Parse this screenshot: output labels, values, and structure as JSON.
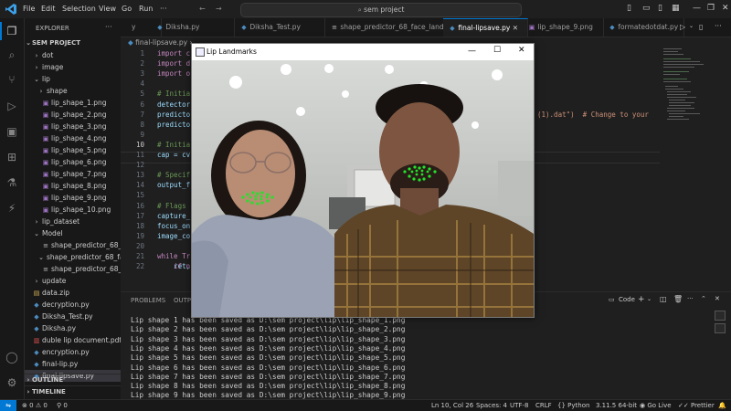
{
  "menu": [
    "File",
    "Edit",
    "Selection",
    "View",
    "Go",
    "Run"
  ],
  "search": {
    "text": "sem project"
  },
  "sidebar": {
    "header": "EXPLORER",
    "project": "SEM PROJECT",
    "items": [
      {
        "label": "dot",
        "type": "folder",
        "open": false
      },
      {
        "label": "image",
        "type": "folder",
        "open": false
      },
      {
        "label": "lip",
        "type": "folder",
        "open": true
      },
      {
        "label": "shape",
        "type": "folder",
        "open": false
      },
      {
        "label": "lip_shape_1.png",
        "type": "img"
      },
      {
        "label": "lip_shape_2.png",
        "type": "img"
      },
      {
        "label": "lip_shape_3.png",
        "type": "img"
      },
      {
        "label": "lip_shape_4.png",
        "type": "img"
      },
      {
        "label": "lip_shape_5.png",
        "type": "img"
      },
      {
        "label": "lip_shape_6.png",
        "type": "img"
      },
      {
        "label": "lip_shape_7.png",
        "type": "img"
      },
      {
        "label": "lip_shape_8.png",
        "type": "img"
      },
      {
        "label": "lip_shape_9.png",
        "type": "img"
      },
      {
        "label": "lip_shape_10.png",
        "type": "img"
      },
      {
        "label": "lip_dataset",
        "type": "folder",
        "open": false
      },
      {
        "label": "Model",
        "type": "folder",
        "open": true
      },
      {
        "label": "shape_predictor_68_f...",
        "type": "file"
      },
      {
        "label": "shape_predictor_68_fa...",
        "type": "folder",
        "open": true
      },
      {
        "label": "shape_predictor_68_f...",
        "type": "file"
      },
      {
        "label": "update",
        "type": "folder",
        "open": false
      },
      {
        "label": "data.zip",
        "type": "zip"
      },
      {
        "label": "decryption.py",
        "type": "py"
      },
      {
        "label": "Diksha_Test.py",
        "type": "py"
      },
      {
        "label": "Diksha.py",
        "type": "py"
      },
      {
        "label": "duble lip document.pdf",
        "type": "pdf"
      },
      {
        "label": "encryption.py",
        "type": "py"
      },
      {
        "label": "final-lip.py",
        "type": "py"
      },
      {
        "label": "final-lipsave.py",
        "type": "py",
        "selected": true
      }
    ],
    "outline": "OUTLINE",
    "timeline": "TIMELINE"
  },
  "tabs": [
    {
      "label": "y"
    },
    {
      "label": "Diksha.py"
    },
    {
      "label": "Diksha_Test.py"
    },
    {
      "label": "shape_predictor_68_face_landmarks.dat"
    },
    {
      "label": "final-lipsave.py",
      "active": true
    },
    {
      "label": "lip_shape_9.png"
    },
    {
      "label": "formatedotdat.py"
    }
  ],
  "breadcrumb": "final-lipsave.py",
  "code": {
    "line_numbers": [
      "1",
      "2",
      "3",
      "4",
      "5",
      "6",
      "7",
      "8",
      "9",
      "10",
      "11",
      "12",
      "13",
      "14",
      "15",
      "16",
      "17",
      "18",
      "19",
      "20",
      "21",
      "22"
    ],
    "lines": [
      "import c",
      "import d",
      "import o",
      "",
      "# Initia",
      "detector",
      "predicto",
      "predicto",
      "",
      "# Initia",
      "cap = cv",
      "",
      "# Specif",
      "output_f",
      "",
      "# Flags ",
      "capture_",
      "focus_on",
      "image_co",
      "",
      "while Tr",
      "    ret,"
    ],
    "extra_line21": "    if n",
    "right_fragment": "(1).dat\")  # Change to your"
  },
  "panel": {
    "tabs": [
      "PROBLEMS",
      "OUTPUT"
    ],
    "shell": "Code",
    "terminal_lines": [
      "Lip shape 1 has been saved as D:\\sem project\\lip\\lip_shape_1.png",
      "Lip shape 2 has been saved as D:\\sem project\\lip\\lip_shape_2.png",
      "Lip shape 3 has been saved as D:\\sem project\\lip\\lip_shape_3.png",
      "Lip shape 4 has been saved as D:\\sem project\\lip\\lip_shape_4.png",
      "Lip shape 5 has been saved as D:\\sem project\\lip\\lip_shape_5.png",
      "Lip shape 6 has been saved as D:\\sem project\\lip\\lip_shape_6.png",
      "Lip shape 7 has been saved as D:\\sem project\\lip\\lip_shape_7.png",
      "Lip shape 8 has been saved as D:\\sem project\\lip\\lip_shape_8.png",
      "Lip shape 9 has been saved as D:\\sem project\\lip\\lip_shape_9.png"
    ]
  },
  "statusbar": {
    "errors": "0",
    "warnings": "0",
    "ports": "0",
    "position": "Ln 10, Col 26",
    "spaces": "Spaces: 4",
    "encoding": "UTF-8",
    "eol": "CRLF",
    "language": "Python",
    "interpreter": "3.11.5 64-bit",
    "golive": "Go Live",
    "prettier": "Prettier"
  },
  "popup": {
    "title": "Lip Landmarks"
  },
  "colors": {
    "accent": "#0078d4",
    "landmark": "#22e32a"
  }
}
